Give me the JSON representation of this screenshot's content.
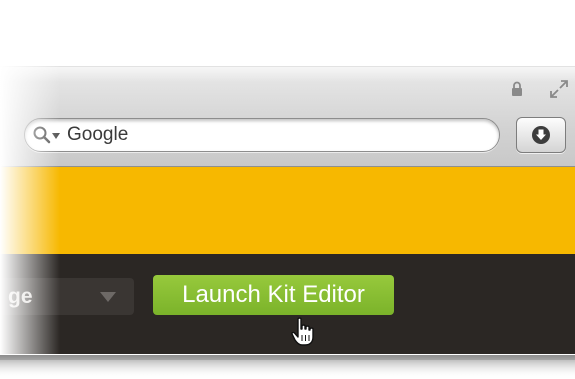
{
  "toolbar": {
    "search": {
      "value": "Google",
      "icon": "magnifier-icon"
    },
    "lock_icon": "lock-icon",
    "fullscreen_icon": "fullscreen-icon",
    "downloads_icon": "download-arrow-icon"
  },
  "page": {
    "banner_color": "#f7b800",
    "navbar_color": "#2b2724",
    "select": {
      "value": "ge"
    },
    "launch_button": {
      "label": "Launch Kit Editor",
      "color": "#8cc036"
    },
    "cursor": "hand-pointer-icon"
  }
}
